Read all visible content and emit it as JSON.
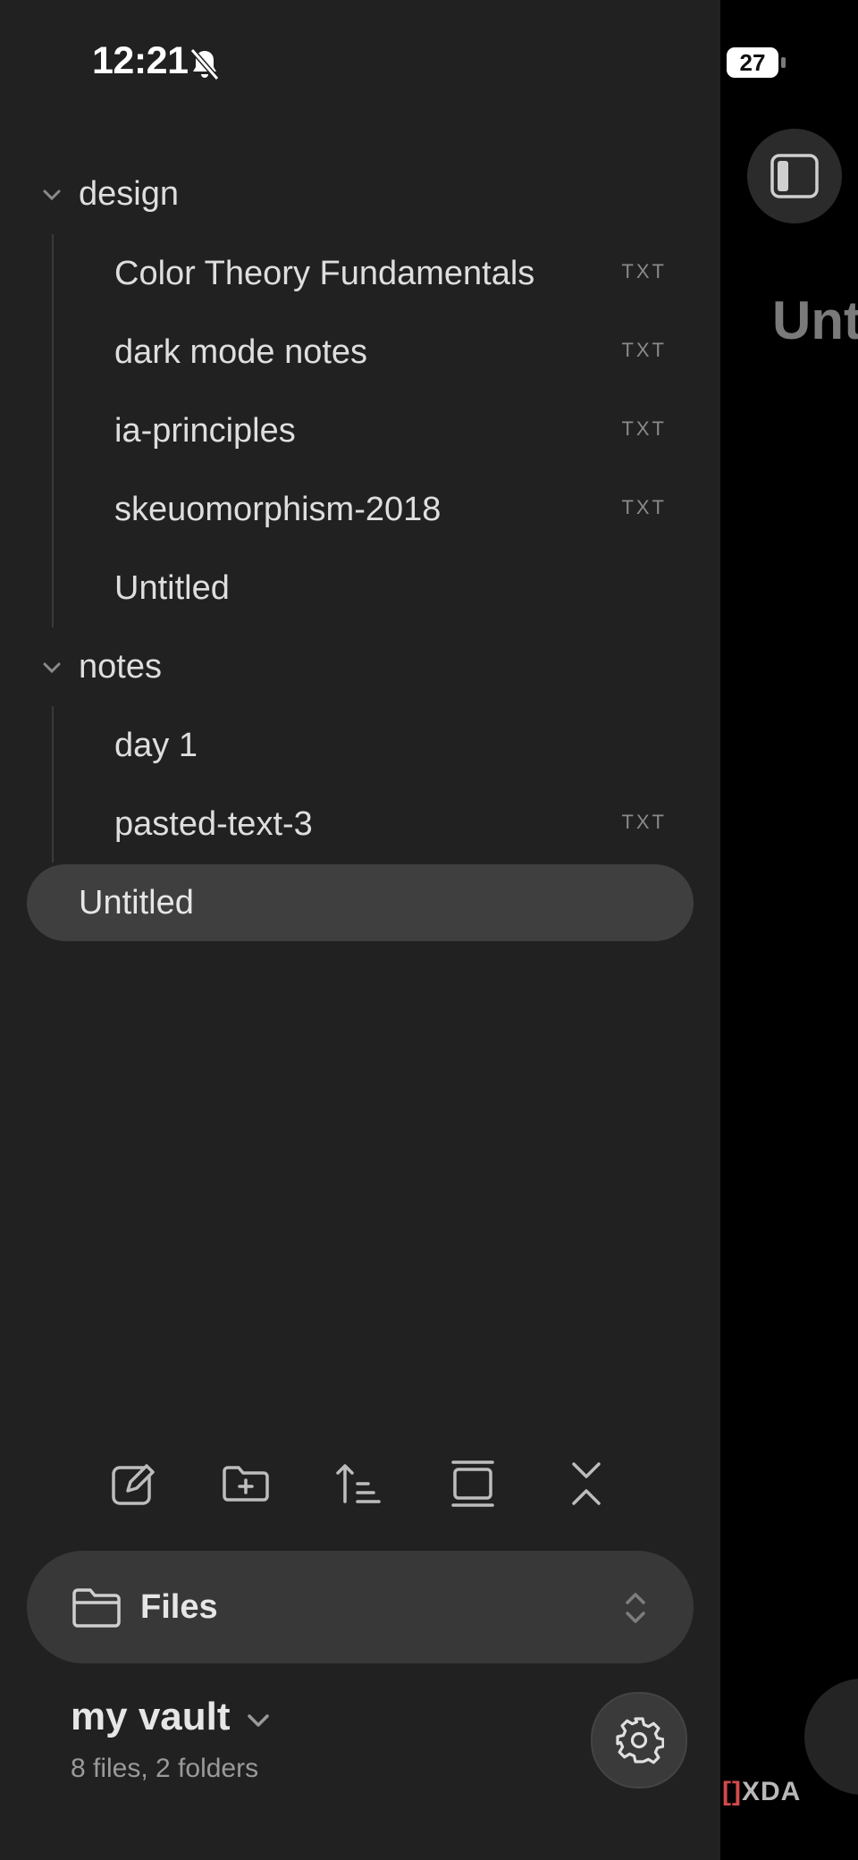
{
  "status_bar": {
    "time": "12:21",
    "battery": "27"
  },
  "tree": {
    "folders": [
      {
        "name": "design",
        "files": [
          {
            "name": "Color Theory Fundamentals",
            "tag": "TXT"
          },
          {
            "name": "dark mode notes",
            "tag": "TXT"
          },
          {
            "name": "ia-principles",
            "tag": "TXT"
          },
          {
            "name": "skeuomorphism-2018",
            "tag": "TXT"
          },
          {
            "name": "Untitled",
            "tag": ""
          }
        ]
      },
      {
        "name": "notes",
        "files": [
          {
            "name": "day 1",
            "tag": ""
          },
          {
            "name": "pasted-text-3",
            "tag": "TXT"
          }
        ]
      }
    ],
    "root_files": [
      {
        "name": "Untitled",
        "selected": true
      }
    ]
  },
  "toolbar": {
    "icons": [
      "new-note-icon",
      "new-folder-icon",
      "sort-icon",
      "expand-all-icon",
      "collapse-all-icon"
    ]
  },
  "files_pill": {
    "label": "Files"
  },
  "vault": {
    "name": "my vault",
    "summary": "8 files, 2 folders"
  },
  "right_pane": {
    "title": "Unt"
  },
  "watermark": {
    "bracket": "[]",
    "text": "XDA"
  }
}
